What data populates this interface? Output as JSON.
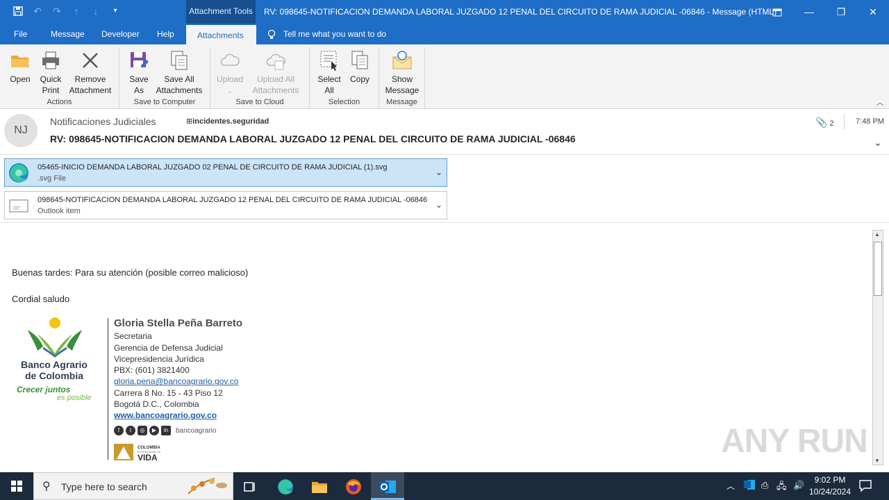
{
  "titlebar": {
    "context_tab": "Attachment Tools",
    "title": "RV: 098645-NOTIFICACION DEMANDA LABORAL JUZGADO 12 PENAL DEL CIRCUITO DE RAMA JUDICIAL -06846  -  Message (HTML)",
    "qat_icons": [
      "save-icon",
      "undo-icon",
      "redo-icon",
      "up-icon",
      "down-icon",
      "customize-icon"
    ]
  },
  "tabs": [
    "File",
    "Message",
    "Developer",
    "Help",
    "Attachments"
  ],
  "tellme": "Tell me what you want to do",
  "ribbon": {
    "groups": [
      {
        "label": "Actions",
        "buttons": [
          {
            "l1": "Open",
            "l2": ""
          },
          {
            "l1": "Quick",
            "l2": "Print"
          },
          {
            "l1": "Remove",
            "l2": "Attachment"
          }
        ]
      },
      {
        "label": "Save to Computer",
        "buttons": [
          {
            "l1": "Save",
            "l2": "As"
          },
          {
            "l1": "Save All",
            "l2": "Attachments"
          }
        ]
      },
      {
        "label": "Save to Cloud",
        "buttons": [
          {
            "l1": "Upload",
            "l2": ""
          },
          {
            "l1": "Upload All",
            "l2": "Attachments"
          }
        ]
      },
      {
        "label": "Selection",
        "buttons": [
          {
            "l1": "Select",
            "l2": "All"
          },
          {
            "l1": "Copy",
            "l2": ""
          }
        ]
      },
      {
        "label": "Message",
        "buttons": [
          {
            "l1": "Show",
            "l2": "Message"
          }
        ]
      }
    ]
  },
  "header": {
    "initials": "NJ",
    "sender": "Notificaciones Judiciales",
    "to": "incidentes.seguridad",
    "subject": "RV: 098645-NOTIFICACION DEMANDA LABORAL JUZGADO 12 PENAL DEL CIRCUITO DE RAMA JUDICIAL -06846",
    "attachment_count": "2",
    "time": "7:48 PM"
  },
  "attachments": [
    {
      "name": "05465-INICIO DEMANDA LABORAL JUZGADO 02 PENAL DE CIRCUITO DE RAMA JUDICIAL (1).svg",
      "type": ".svg File"
    },
    {
      "name": "098645-NOTIFICACION DEMANDA LABORAL JUZGADO 12 PENAL DEL CIRCUITO DE RAMA JUDICIAL -06846",
      "type": "Outlook item"
    }
  ],
  "body": {
    "line1": "Buenas tardes: Para su atención (posible correo malicioso)",
    "line2": "Cordial saludo"
  },
  "logo": {
    "line1": "Banco Agrario",
    "line2": "de Colombia",
    "tag1": "Crecer juntos",
    "tag2": "es posible"
  },
  "signature": {
    "name": "Gloria Stella Peña Barreto",
    "role": "Secretaria",
    "dept": "Gerencia de Defensa Judicial",
    "vp": "Vicepresidencia Jurídica",
    "phone": "PBX: (601) 3821400",
    "email": "gloria.pena@bancoagrario.gov.co",
    "address": "Carrera 8 No. 15 - 43 Piso 12",
    "city": "Bogotá D.C., Colombia",
    "web": "www.bancoagrario.gov.co",
    "social_handle": "bancoagrario",
    "badge_top": "COLOMBIA",
    "badge_sub": "POTENCIA DE LA",
    "badge_main": "VIDA"
  },
  "watermark": "ANY RUN",
  "taskbar": {
    "search_placeholder": "Type here to search",
    "time": "9:02 PM",
    "date": "10/24/2024"
  }
}
